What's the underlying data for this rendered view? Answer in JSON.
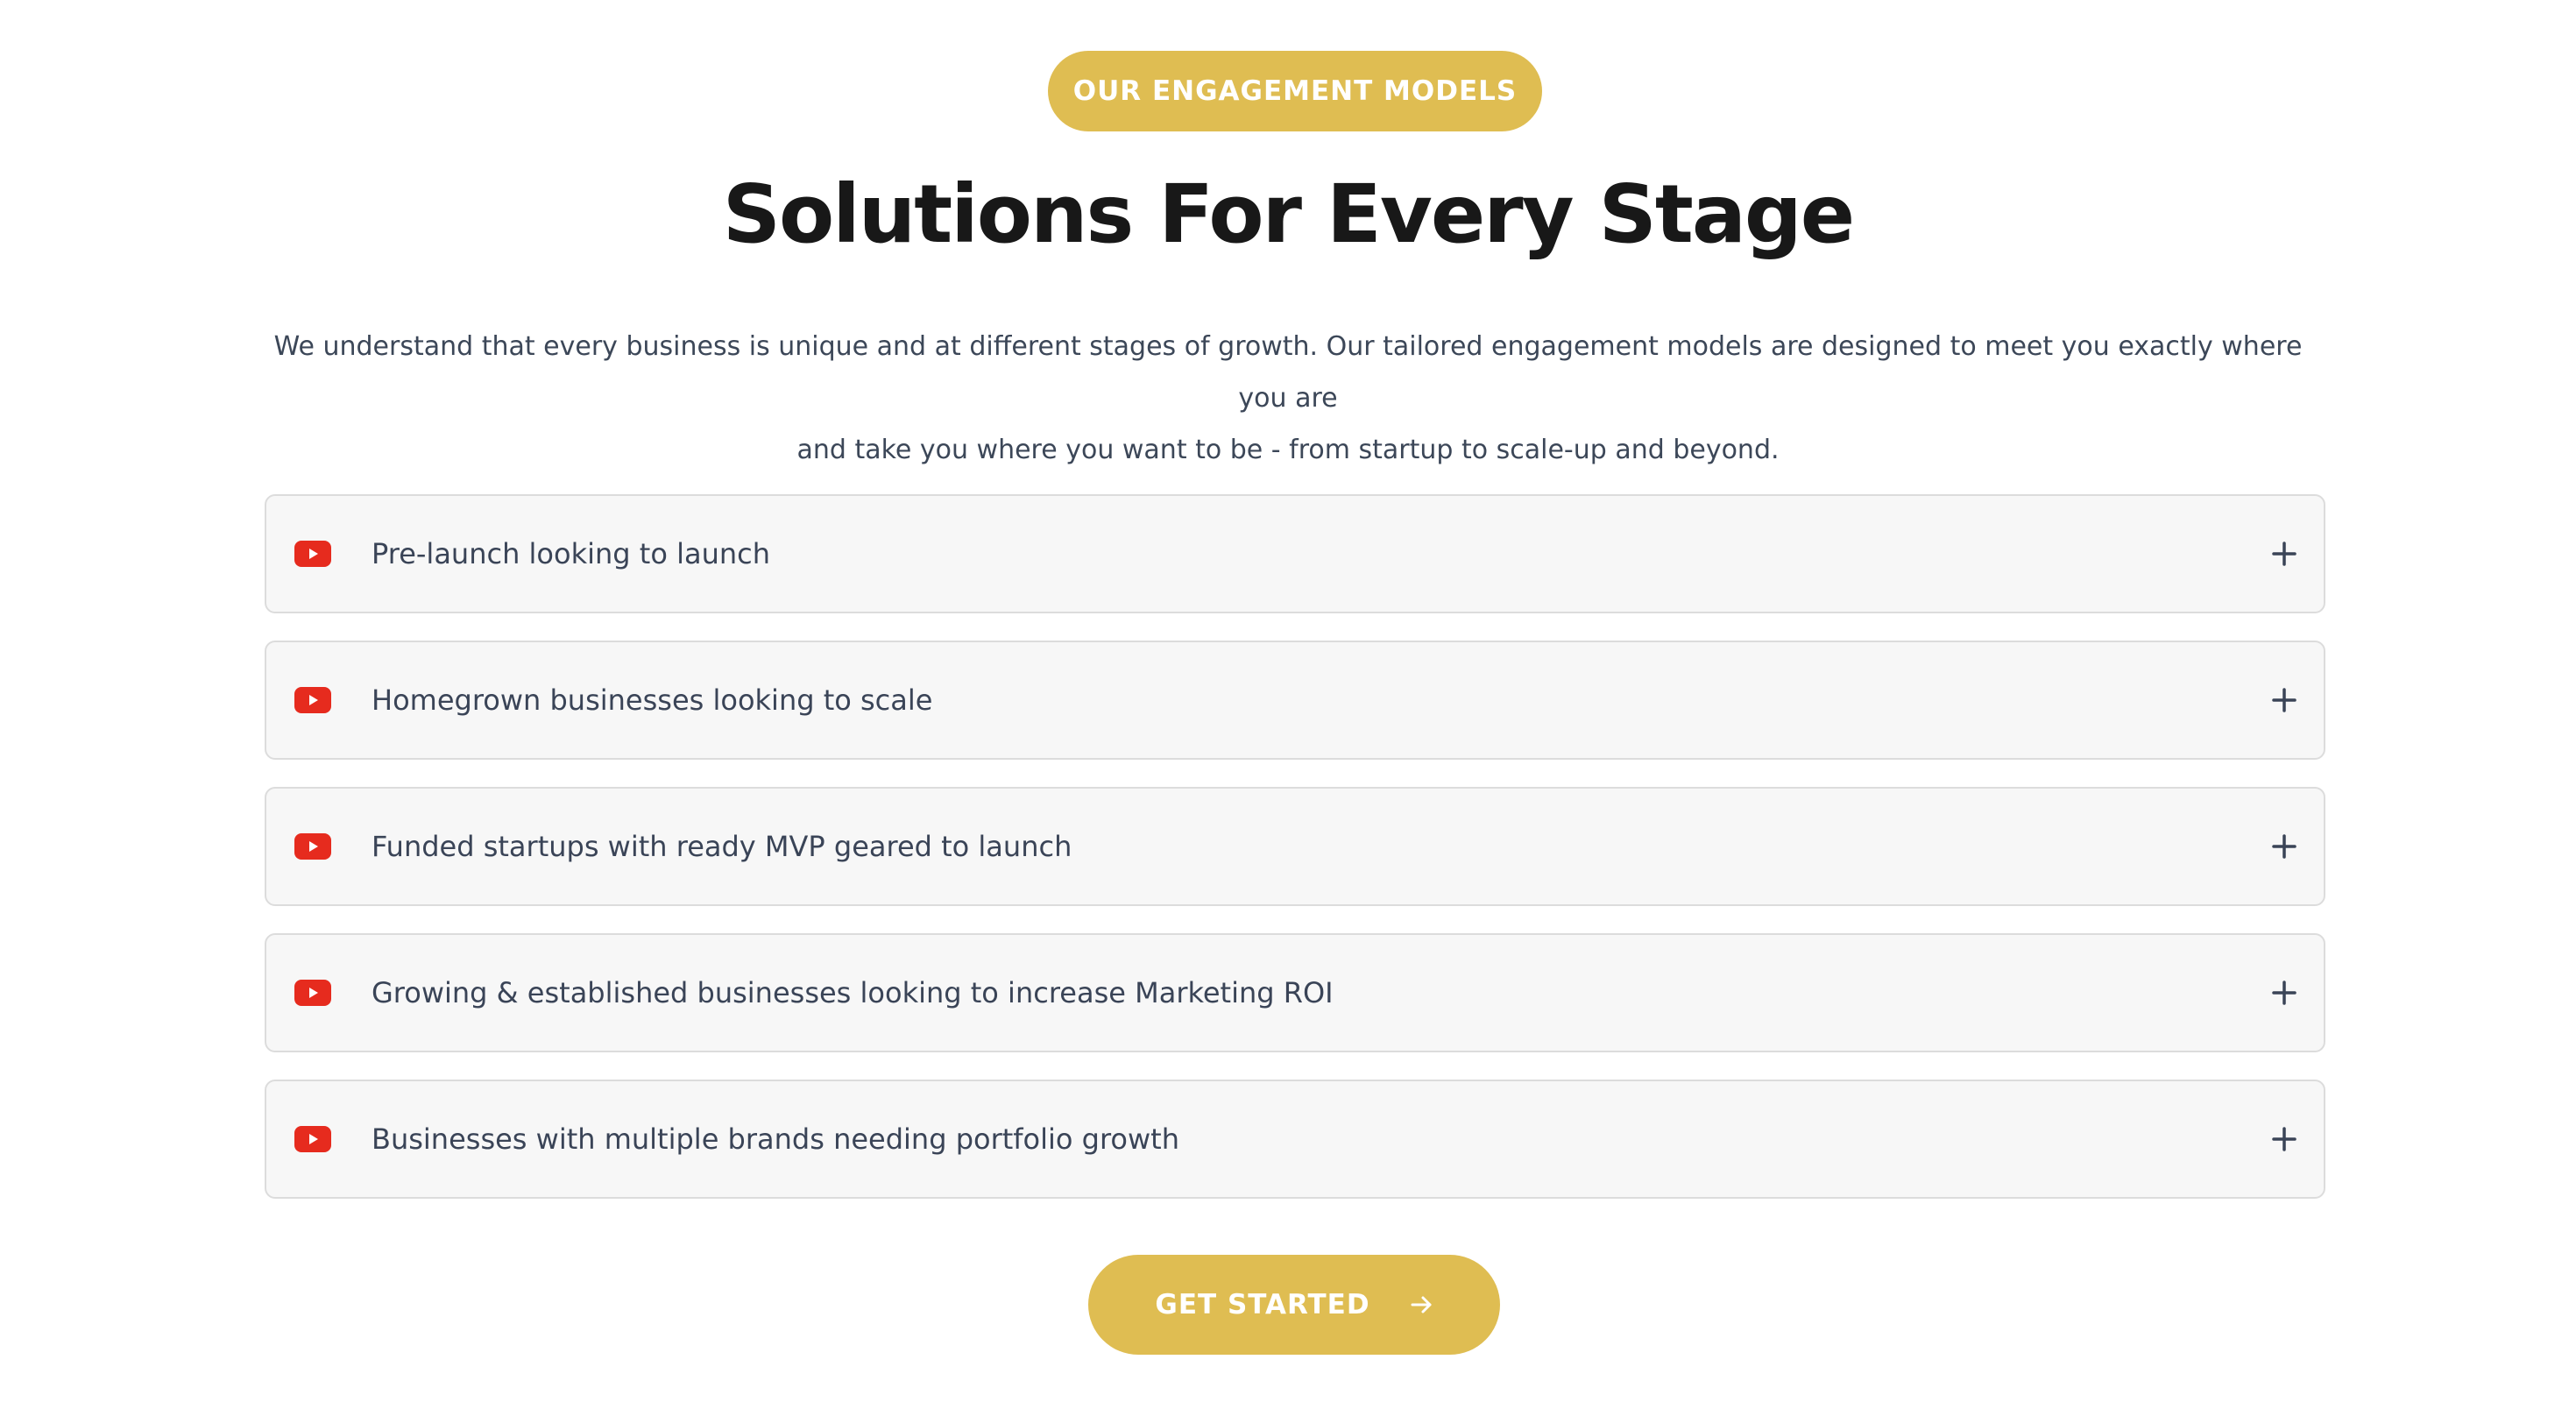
{
  "section": {
    "badge": "OUR ENGAGEMENT MODELS",
    "title": "Solutions For Every Stage",
    "intro_line1": "We understand that every business is unique and at different stages of growth. Our tailored engagement models are designed to meet you exactly where you are",
    "intro_line2": "and take you where you want to be - from startup to scale-up and beyond."
  },
  "accordion": {
    "items": [
      {
        "label": "Pre-launch looking to launch",
        "icon": "youtube-play-icon",
        "expand_icon": "plus-icon"
      },
      {
        "label": "Homegrown businesses looking to scale",
        "icon": "youtube-play-icon",
        "expand_icon": "plus-icon"
      },
      {
        "label": "Funded startups with ready MVP geared to launch",
        "icon": "youtube-play-icon",
        "expand_icon": "plus-icon"
      },
      {
        "label": "Growing & established businesses looking to increase Marketing ROI",
        "icon": "youtube-play-icon",
        "expand_icon": "plus-icon"
      },
      {
        "label": "Businesses with multiple brands needing portfolio growth",
        "icon": "youtube-play-icon",
        "expand_icon": "plus-icon"
      }
    ]
  },
  "cta": {
    "label": "GET STARTED",
    "icon": "arrow-right-icon"
  },
  "colors": {
    "accent": "#dfbd52",
    "icon_red": "#e62b1e",
    "heading": "#181818",
    "body_text": "#3c4758",
    "item_bg": "#f7f7f7",
    "item_border": "#dcdcdc"
  }
}
